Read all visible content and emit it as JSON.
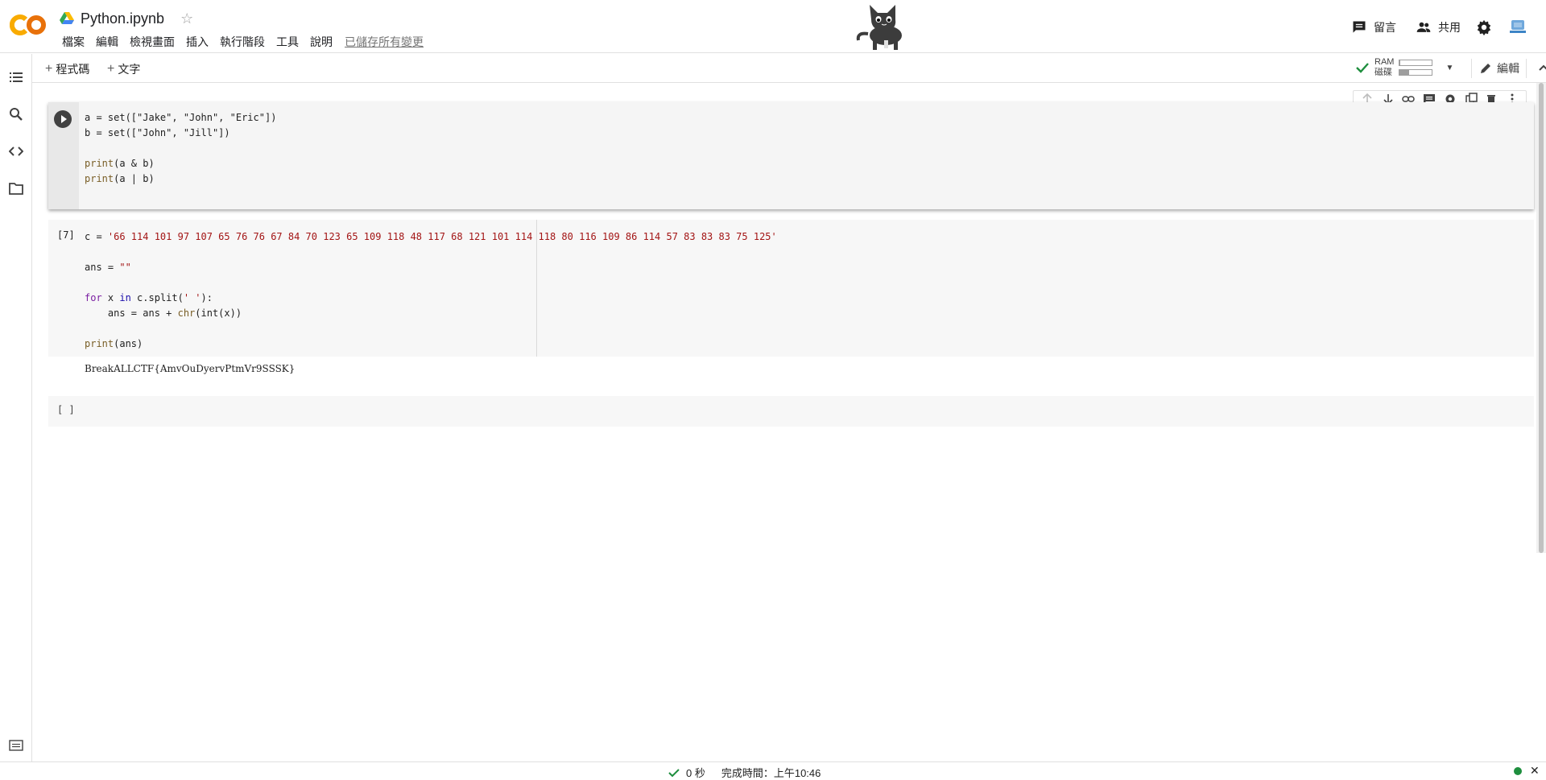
{
  "header": {
    "logo_text": "CO",
    "doc_title": "Python.ipynb",
    "menu": [
      "檔案",
      "編輯",
      "檢視畫面",
      "插入",
      "執行階段",
      "工具",
      "說明"
    ],
    "saved_status": "已儲存所有變更",
    "comment_label": "留言",
    "share_label": "共用"
  },
  "toolbar": {
    "add_code_label": "程式碼",
    "add_text_label": "文字",
    "ram_label": "RAM",
    "disk_label": "磁碟",
    "ram_usage": 0.02,
    "disk_usage": 0.3,
    "edit_label": "編輯"
  },
  "cells": {
    "cell1": {
      "lines": [
        "a = set([\"Jake\", \"John\", \"Eric\"])",
        "b = set([\"John\", \"Jill\"])",
        "",
        "print(a & b)",
        "print(a | b)"
      ]
    },
    "cell2": {
      "exec_count": "[7]",
      "line1_prefix": "c = ",
      "line1_string": "'66 114 101 97 107 65 76 76 67 84 70 123 65 109 118 48 117 68 121 101 114 118 80 116 109 86 114 57 83 83 83 75 125'",
      "line3_prefix": "ans = ",
      "line3_string": "\"\"",
      "line5_for": "for",
      "line5_var": " x ",
      "line5_in": "in",
      "line5_rest_a": " c.split(",
      "line5_str": "' '",
      "line5_rest_b": "):",
      "line6_a": "    ans = ans + ",
      "line6_fn": "chr",
      "line6_b": "(int(x))",
      "line8_fn": "print",
      "line8_b": "(ans)",
      "output": "BreakALLCTF{AmvOuDyervPtmVr9SSSK}"
    },
    "cell3": {
      "exec_count": "[ ]"
    }
  },
  "statusbar": {
    "duration": "0 秒",
    "completed": "完成時間：上午10:46"
  },
  "colors": {
    "logo_orange": "#f9ab00",
    "logo_dark_orange": "#e8710a",
    "string_red": "#a31515",
    "keyword_purple": "#7b1fa2",
    "status_green": "#1e8e3e"
  }
}
